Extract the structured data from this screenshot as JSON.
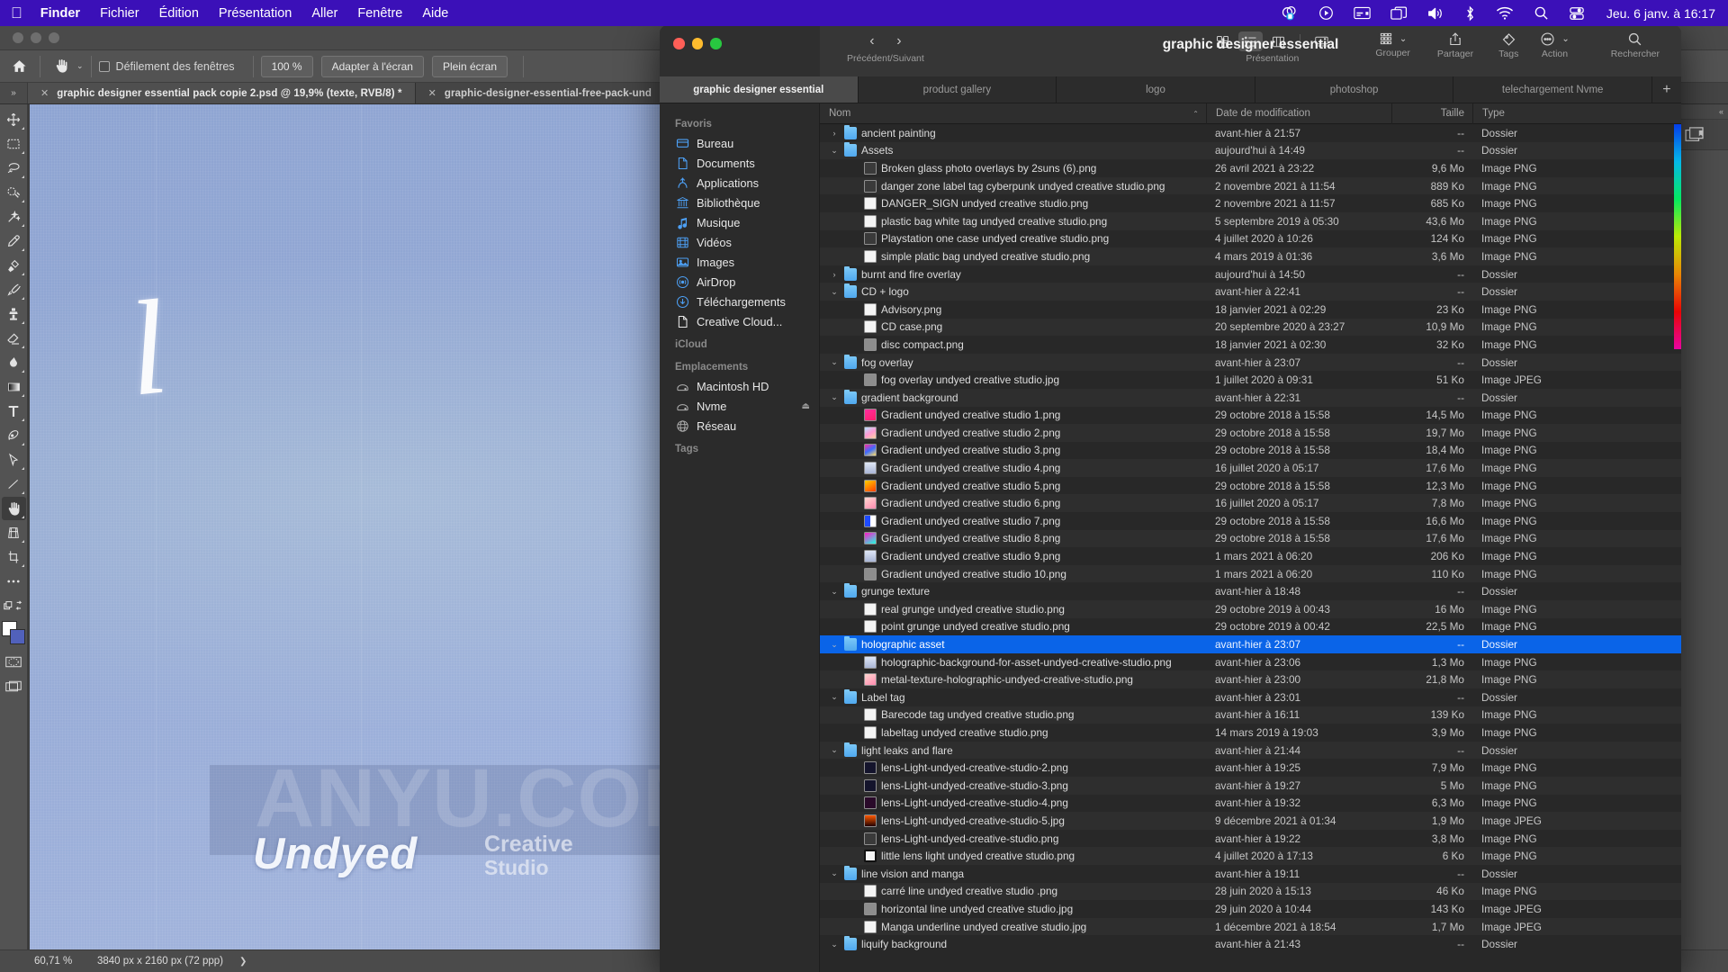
{
  "menubar": {
    "apple_icon": "apple-logo-icon",
    "items": [
      "Finder",
      "Fichier",
      "Édition",
      "Présentation",
      "Aller",
      "Fenêtre",
      "Aide"
    ],
    "status_icons": [
      "screen-record-icon",
      "play-circle-icon",
      "now-playing-icon",
      "mission-control-icon",
      "volume-icon",
      "bluetooth-icon",
      "wifi-icon",
      "search-icon",
      "control-center-icon"
    ],
    "clock": "Jeu. 6 janv. à  16:17"
  },
  "photoshop": {
    "options_bar": {
      "home_icon": "home-icon",
      "tool_icon": "hand-tool-icon",
      "caret": "⌄",
      "scroll_windows_label": "Défilement des fenêtres",
      "zoom_100_label": "100 %",
      "fit_screen_label": "Adapter à l'écran",
      "fullscreen_label": "Plein écran"
    },
    "doc_tabs": [
      {
        "label": "graphic designer essential pack copie 2.psd @ 19,9% (texte, RVB/8) *",
        "active": true
      },
      {
        "label": "graphic-designer-essential-free-pack-und",
        "active": false
      }
    ],
    "tools": [
      "move-tool-icon",
      "marquee-tool-icon",
      "lasso-tool-icon",
      "quick-selection-tool-icon",
      "magic-wand-tool-icon",
      "eyedropper-tool-icon",
      "healing-brush-tool-icon",
      "brush-tool-icon",
      "clone-stamp-tool-icon",
      "eraser-tool-icon",
      "blur-tool-icon",
      "gradient-tool-icon",
      "type-tool-icon",
      "pen-tool-icon",
      "path-selection-tool-icon",
      "line-tool-icon",
      "hand-tool-icon",
      "perspective-crop-tool-icon",
      "crop-tool-icon",
      "more-tools-icon"
    ],
    "selected_tool": "hand-tool-icon",
    "foreground_color": "#ffffff",
    "background_color": "#5161bb",
    "canvas": {
      "brush_letter": "l",
      "watermark_title": "Undyed",
      "watermark_sub_line1": "Creative",
      "watermark_sub_line2": "Studio",
      "overlay_watermark": "ANYU.COM®"
    },
    "status_bar": {
      "zoom": "60,71 %",
      "dimensions": "3840 px x 2160 px (72 ppp)",
      "expand_icon": "chevron-right-icon"
    }
  },
  "finder": {
    "window_title": "graphic designer essential",
    "nav": {
      "back_icon": "chevron-left-icon",
      "forward_icon": "chevron-right-icon",
      "caption": "Précédent/Suivant"
    },
    "toolbar": {
      "view_icons": [
        "icon-view-icon",
        "list-view-icon",
        "column-view-icon",
        "gallery-view-icon"
      ],
      "view_active": "list-view-icon",
      "view_caption": "Présentation",
      "group_icon": "group-icon",
      "group_caption": "Grouper",
      "share_icon": "share-icon",
      "share_caption": "Partager",
      "tags_icon": "tag-icon",
      "tags_caption": "Tags",
      "action_icon": "action-ellipsis-icon",
      "action_caption": "Action",
      "search_icon": "search-icon",
      "search_caption": "Rechercher"
    },
    "tabs": [
      {
        "label": "graphic designer essential",
        "active": true
      },
      {
        "label": "product gallery",
        "active": false
      },
      {
        "label": "logo",
        "active": false
      },
      {
        "label": "photoshop",
        "active": false
      },
      {
        "label": "telechargement Nvme",
        "active": false
      }
    ],
    "tab_add_label": "+",
    "sidebar": [
      {
        "type": "header",
        "label": "Favoris"
      },
      {
        "type": "item",
        "label": "Bureau",
        "icon": "desktop-icon"
      },
      {
        "type": "item",
        "label": "Documents",
        "icon": "document-icon"
      },
      {
        "type": "item",
        "label": "Applications",
        "icon": "applications-icon"
      },
      {
        "type": "item",
        "label": "Bibliothèque",
        "icon": "library-icon"
      },
      {
        "type": "item",
        "label": "Musique",
        "icon": "music-icon"
      },
      {
        "type": "item",
        "label": "Vidéos",
        "icon": "video-icon"
      },
      {
        "type": "item",
        "label": "Images",
        "icon": "pictures-icon"
      },
      {
        "type": "item",
        "label": "AirDrop",
        "icon": "airdrop-icon"
      },
      {
        "type": "item",
        "label": "Téléchargements",
        "icon": "downloads-icon"
      },
      {
        "type": "item",
        "label": "Creative Cloud...",
        "icon": "creative-cloud-file-icon"
      },
      {
        "type": "header",
        "label": "iCloud"
      },
      {
        "type": "header",
        "label": "Emplacements"
      },
      {
        "type": "item",
        "label": "Macintosh HD",
        "icon": "harddisk-icon",
        "grey": true
      },
      {
        "type": "item",
        "label": "Nvme",
        "icon": "harddisk-icon",
        "grey": true,
        "eject": true
      },
      {
        "type": "item",
        "label": "Réseau",
        "icon": "network-globe-icon",
        "grey": true
      },
      {
        "type": "header",
        "label": "Tags"
      }
    ],
    "columns": [
      {
        "key": "name",
        "label": "Nom",
        "sorted": true,
        "sort_caret": "⌃"
      },
      {
        "key": "date",
        "label": "Date de modification"
      },
      {
        "key": "size",
        "label": "Taille"
      },
      {
        "key": "type",
        "label": "Type"
      }
    ],
    "rows": [
      {
        "name": "ancient painting",
        "indent": 0,
        "disc": "›",
        "icon": "folder",
        "date": "avant-hier à 21:57",
        "size": "--",
        "type": "Dossier"
      },
      {
        "name": "Assets",
        "indent": 0,
        "disc": "⌄",
        "icon": "folder",
        "date": "aujourd'hui à 14:49",
        "size": "--",
        "type": "Dossier"
      },
      {
        "name": "Broken glass photo overlays by 2suns (6).png",
        "indent": 1,
        "disc": "",
        "icon": "img dark",
        "date": "26 avril 2021 à 23:22",
        "size": "9,6 Mo",
        "type": "Image PNG"
      },
      {
        "name": "danger zone label tag cyberpunk undyed creative studio.png",
        "indent": 1,
        "disc": "",
        "icon": "img dark",
        "date": "2 novembre 2021 à 11:54",
        "size": "889 Ko",
        "type": "Image PNG"
      },
      {
        "name": "DANGER_SIGN undyed creative studio.png",
        "indent": 1,
        "disc": "",
        "icon": "img white",
        "date": "2 novembre 2021 à 11:57",
        "size": "685 Ko",
        "type": "Image PNG"
      },
      {
        "name": "plastic bag white tag undyed creative studio.png",
        "indent": 1,
        "disc": "",
        "icon": "img white",
        "date": "5 septembre 2019 à 05:30",
        "size": "43,6 Mo",
        "type": "Image PNG"
      },
      {
        "name": "Playstation one case undyed creative studio.png",
        "indent": 1,
        "disc": "",
        "icon": "img dark",
        "date": "4 juillet 2020 à 10:26",
        "size": "124 Ko",
        "type": "Image PNG"
      },
      {
        "name": "simple platic bag undyed creative studio.png",
        "indent": 1,
        "disc": "",
        "icon": "img white",
        "date": "4 mars 2019 à 01:36",
        "size": "3,6 Mo",
        "type": "Image PNG"
      },
      {
        "name": "burnt and fire overlay",
        "indent": 0,
        "disc": "›",
        "icon": "folder",
        "date": "aujourd'hui à 14:50",
        "size": "--",
        "type": "Dossier"
      },
      {
        "name": "CD + logo",
        "indent": 0,
        "disc": "⌄",
        "icon": "folder",
        "date": "avant-hier à 22:41",
        "size": "--",
        "type": "Dossier"
      },
      {
        "name": "Advisory.png",
        "indent": 1,
        "disc": "",
        "icon": "img white",
        "date": "18 janvier 2021 à 02:29",
        "size": "23 Ko",
        "type": "Image PNG"
      },
      {
        "name": "CD case.png",
        "indent": 1,
        "disc": "",
        "icon": "img white",
        "date": "20 septembre 2020 à 23:27",
        "size": "10,9 Mo",
        "type": "Image PNG"
      },
      {
        "name": "disc compact.png",
        "indent": 1,
        "disc": "",
        "icon": "img grey",
        "date": "18 janvier 2021 à 02:30",
        "size": "32 Ko",
        "type": "Image PNG"
      },
      {
        "name": "fog overlay",
        "indent": 0,
        "disc": "⌄",
        "icon": "folder",
        "date": "avant-hier à 23:07",
        "size": "--",
        "type": "Dossier"
      },
      {
        "name": "fog overlay undyed creative studio.jpg",
        "indent": 1,
        "disc": "",
        "icon": "img grey",
        "date": "1 juillet 2020 à 09:31",
        "size": "51 Ko",
        "type": "Image JPEG"
      },
      {
        "name": "gradient background",
        "indent": 0,
        "disc": "⌄",
        "icon": "folder",
        "date": "avant-hier à 22:31",
        "size": "--",
        "type": "Dossier"
      },
      {
        "name": "Gradient undyed creative studio 1.png",
        "indent": 1,
        "disc": "",
        "icon": "img grad1",
        "date": "29 octobre 2018 à 15:58",
        "size": "14,5 Mo",
        "type": "Image PNG"
      },
      {
        "name": "Gradient undyed creative studio 2.png",
        "indent": 1,
        "disc": "",
        "icon": "img grad2",
        "date": "29 octobre 2018 à 15:58",
        "size": "19,7 Mo",
        "type": "Image PNG"
      },
      {
        "name": "Gradient undyed creative studio 3.png",
        "indent": 1,
        "disc": "",
        "icon": "img grad3",
        "date": "29 octobre 2018 à 15:58",
        "size": "18,4 Mo",
        "type": "Image PNG"
      },
      {
        "name": "Gradient undyed creative studio 4.png",
        "indent": 1,
        "disc": "",
        "icon": "img grad4",
        "date": "16 juillet 2020 à 05:17",
        "size": "17,6 Mo",
        "type": "Image PNG"
      },
      {
        "name": "Gradient undyed creative studio 5.png",
        "indent": 1,
        "disc": "",
        "icon": "img grad5",
        "date": "29 octobre 2018 à 15:58",
        "size": "12,3 Mo",
        "type": "Image PNG"
      },
      {
        "name": "Gradient undyed creative studio 6.png",
        "indent": 1,
        "disc": "",
        "icon": "img grad6",
        "date": "16 juillet 2020 à 05:17",
        "size": "7,8 Mo",
        "type": "Image PNG"
      },
      {
        "name": "Gradient undyed creative studio 7.png",
        "indent": 1,
        "disc": "",
        "icon": "img grad7",
        "date": "29 octobre 2018 à 15:58",
        "size": "16,6 Mo",
        "type": "Image PNG"
      },
      {
        "name": "Gradient undyed creative studio 8.png",
        "indent": 1,
        "disc": "",
        "icon": "img grad8",
        "date": "29 octobre 2018 à 15:58",
        "size": "17,6 Mo",
        "type": "Image PNG"
      },
      {
        "name": "Gradient undyed creative studio 9.png",
        "indent": 1,
        "disc": "",
        "icon": "img grad4",
        "date": "1 mars 2021 à 06:20",
        "size": "206 Ko",
        "type": "Image PNG"
      },
      {
        "name": "Gradient undyed creative studio 10.png",
        "indent": 1,
        "disc": "",
        "icon": "img grey",
        "date": "1 mars 2021 à 06:20",
        "size": "110 Ko",
        "type": "Image PNG"
      },
      {
        "name": "grunge texture",
        "indent": 0,
        "disc": "⌄",
        "icon": "folder",
        "date": "avant-hier à 18:48",
        "size": "--",
        "type": "Dossier"
      },
      {
        "name": " real grunge undyed creative studio.png",
        "indent": 1,
        "disc": "",
        "icon": "img white",
        "date": "29 octobre 2019 à 00:43",
        "size": "16 Mo",
        "type": "Image PNG"
      },
      {
        "name": "point grunge undyed creative studio.png",
        "indent": 1,
        "disc": "",
        "icon": "img white",
        "date": "29 octobre 2019 à 00:42",
        "size": "22,5 Mo",
        "type": "Image PNG"
      },
      {
        "name": "holographic asset",
        "indent": 0,
        "disc": "⌄",
        "icon": "folder",
        "date": "avant-hier à 23:07",
        "size": "--",
        "type": "Dossier",
        "selected": true
      },
      {
        "name": "holographic-background-for-asset-undyed-creative-studio.png",
        "indent": 1,
        "disc": "",
        "icon": "img grad4",
        "date": "avant-hier à 23:06",
        "size": "1,3 Mo",
        "type": "Image PNG"
      },
      {
        "name": "metal-texture-holographic-undyed-creative-studio.png",
        "indent": 1,
        "disc": "",
        "icon": "img grad6",
        "date": "avant-hier à 23:00",
        "size": "21,8 Mo",
        "type": "Image PNG"
      },
      {
        "name": "Label tag",
        "indent": 0,
        "disc": "⌄",
        "icon": "folder",
        "date": "avant-hier à 23:01",
        "size": "--",
        "type": "Dossier"
      },
      {
        "name": "Barecode tag undyed creative studio.png",
        "indent": 1,
        "disc": "",
        "icon": "img white",
        "date": "avant-hier à 16:11",
        "size": "139 Ko",
        "type": "Image PNG"
      },
      {
        "name": "labeltag undyed creative studio.png",
        "indent": 1,
        "disc": "",
        "icon": "img white",
        "date": "14 mars 2019 à 19:03",
        "size": "3,9 Mo",
        "type": "Image PNG"
      },
      {
        "name": "light leaks and flare",
        "indent": 0,
        "disc": "⌄",
        "icon": "folder",
        "date": "avant-hier à 21:44",
        "size": "--",
        "type": "Dossier"
      },
      {
        "name": "lens-Light-undyed-creative-studio-2.png",
        "indent": 1,
        "disc": "",
        "icon": "img lens",
        "date": "avant-hier à 19:25",
        "size": "7,9 Mo",
        "type": "Image PNG"
      },
      {
        "name": "lens-Light-undyed-creative-studio-3.png",
        "indent": 1,
        "disc": "",
        "icon": "img lens",
        "date": "avant-hier à 19:27",
        "size": "5 Mo",
        "type": "Image PNG"
      },
      {
        "name": "lens-Light-undyed-creative-studio-4.png",
        "indent": 1,
        "disc": "",
        "icon": "img lens2",
        "date": "avant-hier à 19:32",
        "size": "6,3 Mo",
        "type": "Image PNG"
      },
      {
        "name": "lens-Light-undyed-creative-studio-5.jpg",
        "indent": 1,
        "disc": "",
        "icon": "img lens3",
        "date": "9 décembre 2021 à 01:34",
        "size": "1,9 Mo",
        "type": "Image JPEG"
      },
      {
        "name": "lens-Light-undyed-creative-studio.png",
        "indent": 1,
        "disc": "",
        "icon": "img dark",
        "date": "avant-hier à 19:22",
        "size": "3,8 Mo",
        "type": "Image PNG"
      },
      {
        "name": "little lens light undyed creative studio.png",
        "indent": 1,
        "disc": "",
        "icon": "img black",
        "date": "4 juillet 2020 à 17:13",
        "size": "6 Ko",
        "type": "Image PNG"
      },
      {
        "name": "line vision and manga",
        "indent": 0,
        "disc": "⌄",
        "icon": "folder",
        "date": "avant-hier à 19:11",
        "size": "--",
        "type": "Dossier"
      },
      {
        "name": "carré line undyed creative studio .png",
        "indent": 1,
        "disc": "",
        "icon": "img white",
        "date": "28 juin 2020 à 15:13",
        "size": "46 Ko",
        "type": "Image PNG"
      },
      {
        "name": "horizontal line undyed creative studio.jpg",
        "indent": 1,
        "disc": "",
        "icon": "img grey",
        "date": "29 juin 2020 à 10:44",
        "size": "143 Ko",
        "type": "Image JPEG"
      },
      {
        "name": "Manga underline undyed creative studio.jpg",
        "indent": 1,
        "disc": "",
        "icon": "img white",
        "date": "1 décembre 2021 à 18:54",
        "size": "1,7 Mo",
        "type": "Image JPEG"
      },
      {
        "name": "liquify background",
        "indent": 0,
        "disc": "⌄",
        "icon": "folder",
        "date": "avant-hier à 21:43",
        "size": "--",
        "type": "Dossier"
      }
    ]
  }
}
